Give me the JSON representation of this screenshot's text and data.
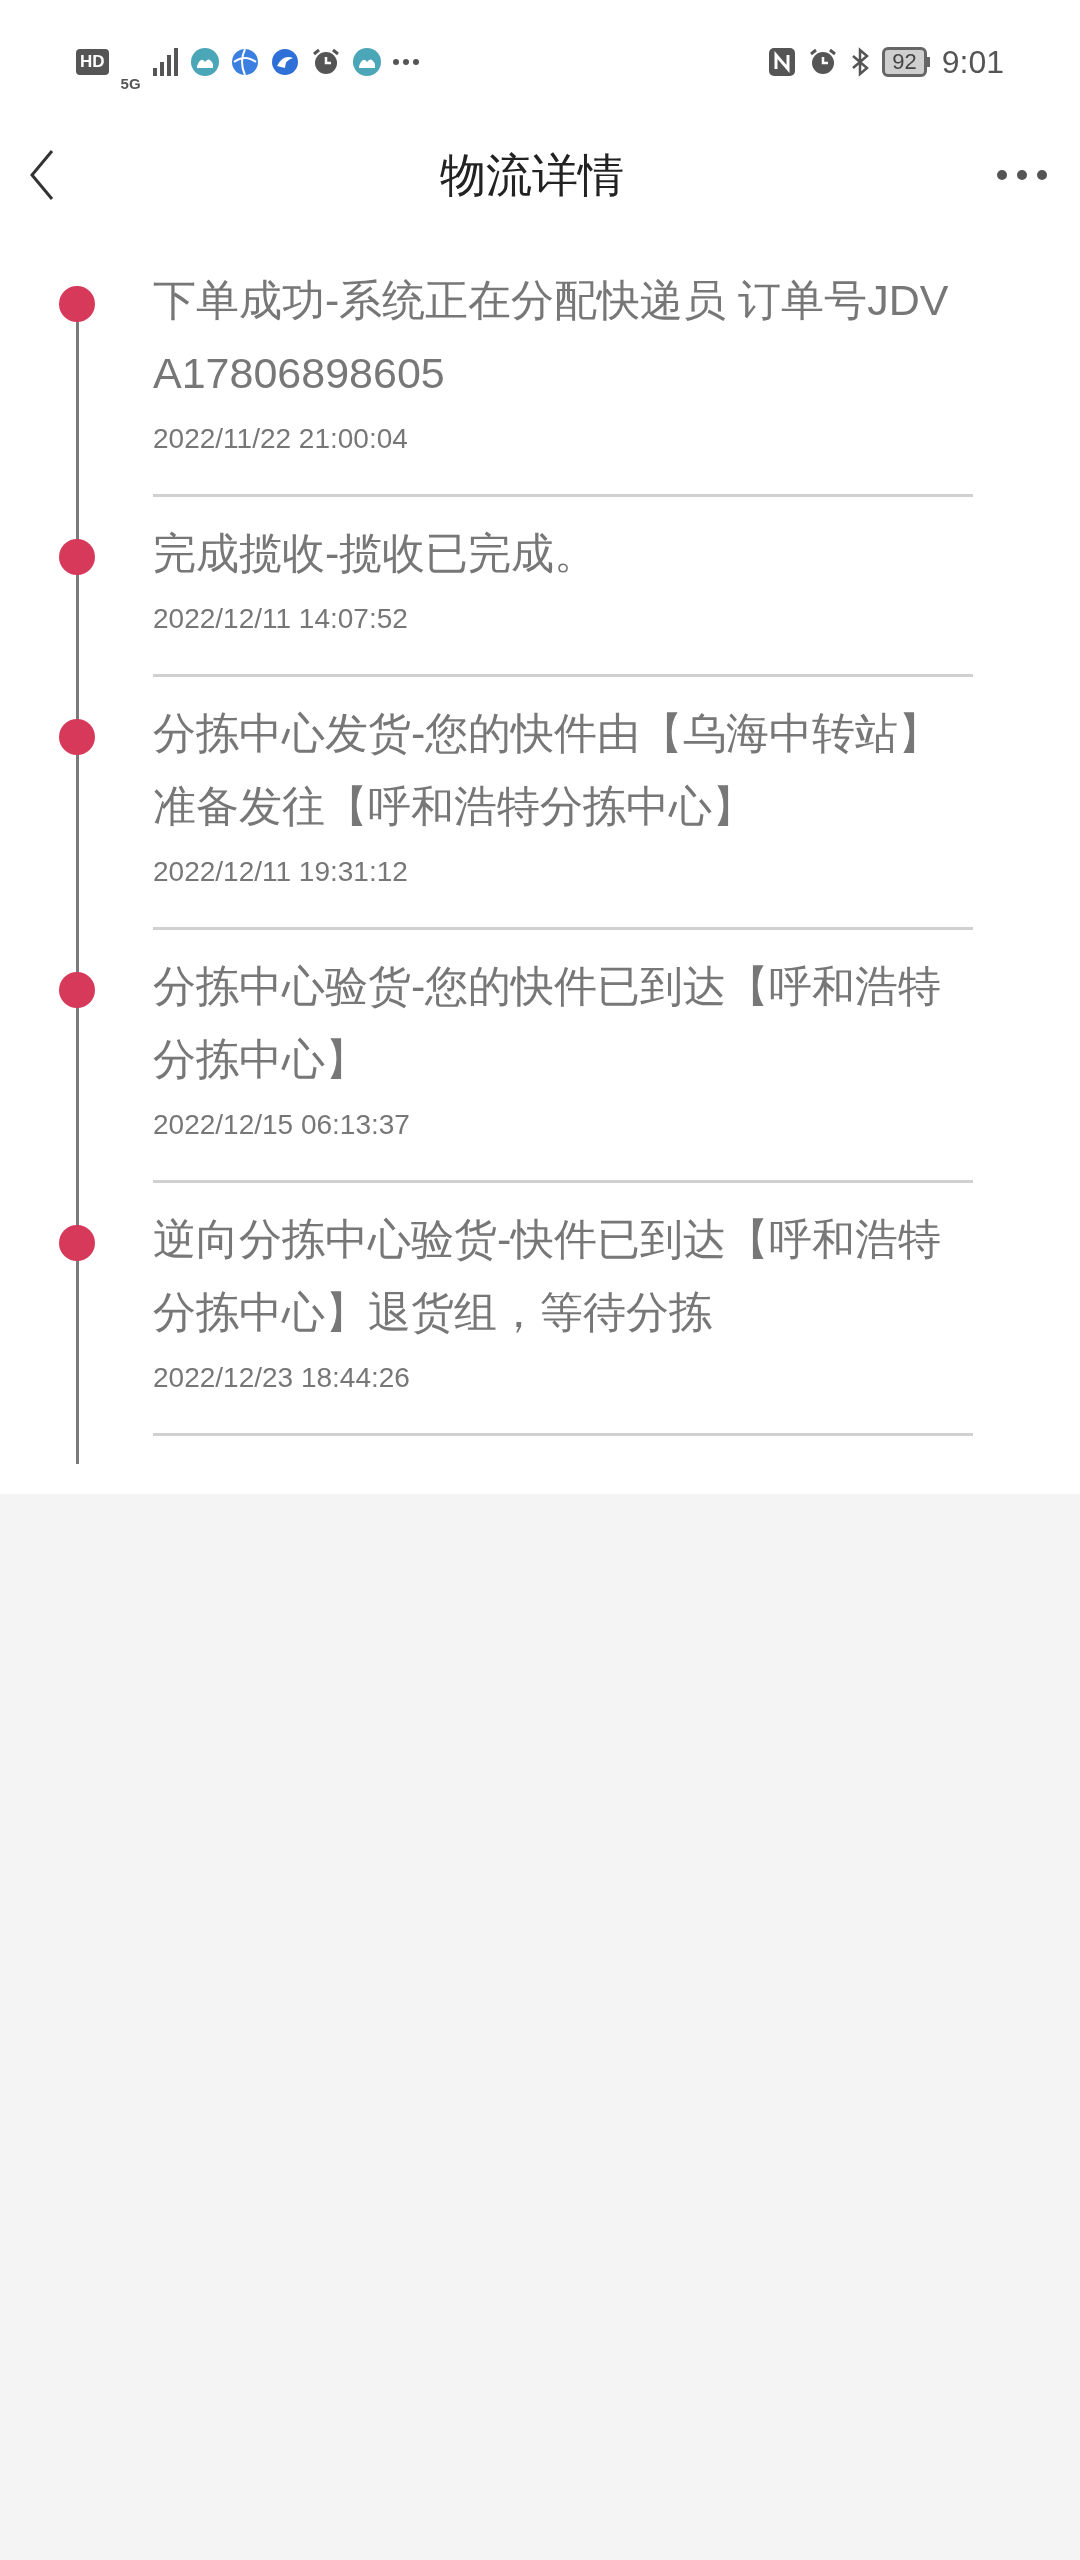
{
  "status_bar": {
    "hd": "HD",
    "network": "5G",
    "battery": "92",
    "time": "9:01"
  },
  "header": {
    "title": "物流详情"
  },
  "events": [
    {
      "text": "下单成功-系统正在分配快递员 订单号JDVA17806898605",
      "time": "2022/11/22 21:00:04"
    },
    {
      "text": "完成揽收-揽收已完成。",
      "time": "2022/12/11 14:07:52"
    },
    {
      "text": "分拣中心发货-您的快件由【乌海中转站】准备发往【呼和浩特分拣中心】",
      "time": "2022/12/11 19:31:12"
    },
    {
      "text": "分拣中心验货-您的快件已到达【呼和浩特分拣中心】",
      "time": "2022/12/15 06:13:37"
    },
    {
      "text": "逆向分拣中心验货-快件已到达【呼和浩特分拣中心】退货组，等待分拣",
      "time": "2022/12/23 18:44:26"
    }
  ]
}
